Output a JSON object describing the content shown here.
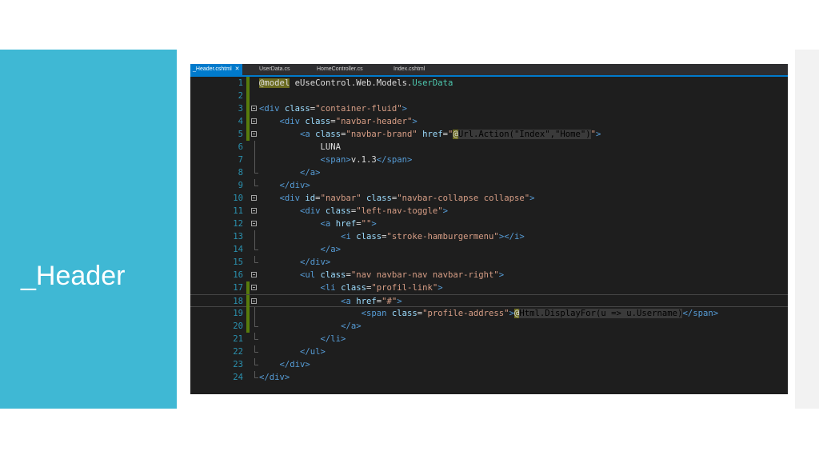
{
  "slide": {
    "title": "_Header"
  },
  "ide": {
    "tabs": [
      {
        "label": "_Header.cshtml",
        "active": true,
        "close": "✕"
      },
      {
        "label": "UserData.cs",
        "active": false
      },
      {
        "label": "HomeController.cs",
        "active": false
      },
      {
        "label": "Index.cshtml",
        "active": false
      }
    ],
    "current_line": 18,
    "lines": [
      {
        "n": "1",
        "parts": [
          [
            "at",
            "@model"
          ],
          [
            "plain",
            " "
          ],
          [
            "plain",
            "eUseControl.Web.Models."
          ],
          [
            "type",
            "UserData"
          ]
        ]
      },
      {
        "n": "2",
        "parts": []
      },
      {
        "n": "3",
        "parts": [
          [
            "tag",
            "<div "
          ],
          [
            "attr",
            "class"
          ],
          [
            "plain",
            "="
          ],
          [
            "str",
            "\"container-fluid\""
          ],
          [
            "tag",
            ">"
          ]
        ]
      },
      {
        "n": "4",
        "parts": [
          [
            "plain",
            "    "
          ],
          [
            "tag",
            "<div "
          ],
          [
            "attr",
            "class"
          ],
          [
            "plain",
            "="
          ],
          [
            "str",
            "\"navbar-header\""
          ],
          [
            "tag",
            ">"
          ]
        ]
      },
      {
        "n": "5",
        "parts": [
          [
            "plain",
            "        "
          ],
          [
            "tag",
            "<a "
          ],
          [
            "attr",
            "class"
          ],
          [
            "plain",
            "="
          ],
          [
            "str",
            "\"navbar-brand\""
          ],
          [
            "plain",
            " "
          ],
          [
            "attr",
            "href"
          ],
          [
            "plain",
            "="
          ],
          [
            "str",
            "\""
          ],
          [
            "at",
            "@"
          ],
          [
            "razor",
            "Url.Action(\"Index\",\"Home\")"
          ],
          [
            "str",
            "\""
          ],
          [
            "tag",
            ">"
          ]
        ]
      },
      {
        "n": "6",
        "parts": [
          [
            "plain",
            "            LUNA"
          ]
        ]
      },
      {
        "n": "7",
        "parts": [
          [
            "plain",
            "            "
          ],
          [
            "tag",
            "<span>"
          ],
          [
            "plain",
            "v.1.3"
          ],
          [
            "tag",
            "</span>"
          ]
        ]
      },
      {
        "n": "8",
        "parts": [
          [
            "plain",
            "        "
          ],
          [
            "tag",
            "</a>"
          ]
        ]
      },
      {
        "n": "9",
        "parts": [
          [
            "plain",
            "    "
          ],
          [
            "tag",
            "</div>"
          ]
        ]
      },
      {
        "n": "10",
        "parts": [
          [
            "plain",
            "    "
          ],
          [
            "tag",
            "<div "
          ],
          [
            "attr",
            "id"
          ],
          [
            "plain",
            "="
          ],
          [
            "str",
            "\"navbar\""
          ],
          [
            "plain",
            " "
          ],
          [
            "attr",
            "class"
          ],
          [
            "plain",
            "="
          ],
          [
            "str",
            "\"navbar-collapse collapse\""
          ],
          [
            "tag",
            ">"
          ]
        ]
      },
      {
        "n": "11",
        "parts": [
          [
            "plain",
            "        "
          ],
          [
            "tag",
            "<div "
          ],
          [
            "attr",
            "class"
          ],
          [
            "plain",
            "="
          ],
          [
            "str",
            "\"left-nav-toggle\""
          ],
          [
            "tag",
            ">"
          ]
        ]
      },
      {
        "n": "12",
        "parts": [
          [
            "plain",
            "            "
          ],
          [
            "tag",
            "<a "
          ],
          [
            "attr",
            "href"
          ],
          [
            "plain",
            "="
          ],
          [
            "str",
            "\"\""
          ],
          [
            "tag",
            ">"
          ]
        ]
      },
      {
        "n": "13",
        "parts": [
          [
            "plain",
            "                "
          ],
          [
            "tag",
            "<i "
          ],
          [
            "attr",
            "class"
          ],
          [
            "plain",
            "="
          ],
          [
            "str",
            "\"stroke-hamburgermenu\""
          ],
          [
            "tag",
            "></i>"
          ]
        ]
      },
      {
        "n": "14",
        "parts": [
          [
            "plain",
            "            "
          ],
          [
            "tag",
            "</a>"
          ]
        ]
      },
      {
        "n": "15",
        "parts": [
          [
            "plain",
            "        "
          ],
          [
            "tag",
            "</div>"
          ]
        ]
      },
      {
        "n": "16",
        "parts": [
          [
            "plain",
            "        "
          ],
          [
            "tag",
            "<ul "
          ],
          [
            "attr",
            "class"
          ],
          [
            "plain",
            "="
          ],
          [
            "str",
            "\"nav navbar-nav navbar-right\""
          ],
          [
            "tag",
            ">"
          ]
        ]
      },
      {
        "n": "17",
        "parts": [
          [
            "plain",
            "            "
          ],
          [
            "tag",
            "<li "
          ],
          [
            "attr",
            "class"
          ],
          [
            "plain",
            "="
          ],
          [
            "str",
            "\"profil-link\""
          ],
          [
            "tag",
            ">"
          ]
        ]
      },
      {
        "n": "18",
        "parts": [
          [
            "plain",
            "                "
          ],
          [
            "tag",
            "<a "
          ],
          [
            "attr",
            "href"
          ],
          [
            "plain",
            "="
          ],
          [
            "str",
            "\"#\""
          ],
          [
            "tag",
            ">"
          ]
        ]
      },
      {
        "n": "19",
        "parts": [
          [
            "plain",
            "                    "
          ],
          [
            "tag",
            "<span "
          ],
          [
            "attr",
            "class"
          ],
          [
            "plain",
            "="
          ],
          [
            "str",
            "\"profile-address\""
          ],
          [
            "tag",
            ">"
          ],
          [
            "at",
            "@"
          ],
          [
            "razor",
            "Html.DisplayFor(u => u.Username)"
          ],
          [
            "tag",
            "</span>"
          ]
        ]
      },
      {
        "n": "20",
        "parts": [
          [
            "plain",
            "                "
          ],
          [
            "tag",
            "</a>"
          ]
        ]
      },
      {
        "n": "21",
        "parts": [
          [
            "plain",
            "            "
          ],
          [
            "tag",
            "</li>"
          ]
        ]
      },
      {
        "n": "22",
        "parts": [
          [
            "plain",
            "        "
          ],
          [
            "tag",
            "</ul>"
          ]
        ]
      },
      {
        "n": "23",
        "parts": [
          [
            "plain",
            "    "
          ],
          [
            "tag",
            "</div>"
          ]
        ]
      },
      {
        "n": "24",
        "parts": [
          [
            "tag",
            "</div>"
          ]
        ]
      }
    ]
  }
}
